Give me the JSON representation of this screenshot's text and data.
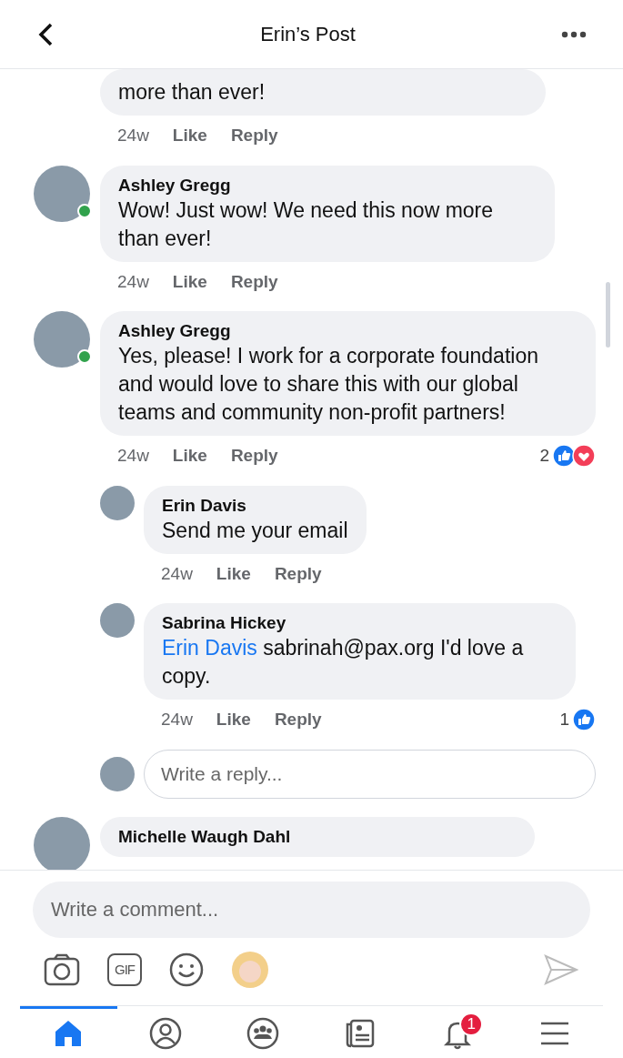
{
  "header": {
    "title": "Erin’s Post"
  },
  "comments": [
    {
      "kind": "tail",
      "text": "more than ever!",
      "time": "24w",
      "like": "Like",
      "reply": "Reply"
    },
    {
      "kind": "full",
      "author": "Ashley Gregg",
      "online": true,
      "text": "Wow! Just wow! We need this now more than ever!",
      "time": "24w",
      "like": "Like",
      "reply": "Reply"
    },
    {
      "kind": "full",
      "author": "Ashley Gregg",
      "online": true,
      "text": "Yes, please! I work for a corporate foundation and would love to share this with our global teams and community non-profit partners!",
      "time": "24w",
      "like": "Like",
      "reply": "Reply",
      "reaction_count": "2",
      "reactions": [
        {
          "kind": "like"
        },
        {
          "kind": "love"
        }
      ],
      "replies": [
        {
          "author": "Erin Davis",
          "text": "Send me your email",
          "time": "24w",
          "like": "Like",
          "reply": "Reply"
        },
        {
          "author": "Sabrina Hickey",
          "mention": "Erin Davis",
          "text": "sabrinah@pax.org I'd love a copy.",
          "time": "24w",
          "like": "Like",
          "reply": "Reply",
          "reaction_count": "1",
          "reactions": [
            {
              "kind": "like"
            }
          ]
        }
      ],
      "reply_box": {
        "placeholder": "Write a reply..."
      }
    },
    {
      "kind": "head",
      "author": "Michelle Waugh Dahl"
    }
  ],
  "composer": {
    "placeholder": "Write a comment...",
    "gif_label": "GIF"
  },
  "tabs": [
    {
      "selected": true
    },
    {
      "selected": false
    },
    {
      "selected": false
    },
    {
      "selected": false
    },
    {
      "selected": false,
      "badge": "1"
    },
    {
      "selected": false
    }
  ]
}
